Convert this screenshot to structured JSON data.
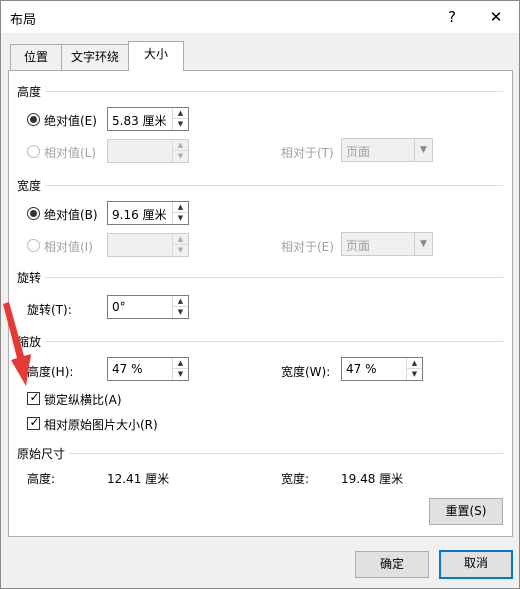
{
  "window": {
    "title": "布局",
    "help": "?",
    "close": "✕"
  },
  "tabs": [
    {
      "label": "位置"
    },
    {
      "label": "文字环绕"
    },
    {
      "label": "大小"
    }
  ],
  "height_section": {
    "title": "高度",
    "absolute_label": "绝对值(E)",
    "absolute_value": "5.83 厘米",
    "relative_label": "相对值(L)",
    "relative_to_label": "相对于(T)",
    "relative_to_value": "页面"
  },
  "width_section": {
    "title": "宽度",
    "absolute_label": "绝对值(B)",
    "absolute_value": "9.16 厘米",
    "relative_label": "相对值(I)",
    "relative_to_label": "相对于(E)",
    "relative_to_value": "页面"
  },
  "rotate_section": {
    "title": "旋转",
    "rotate_label": "旋转(T):",
    "rotate_value": "0°"
  },
  "scale_section": {
    "title": "缩放",
    "height_label": "高度(H):",
    "height_value": "47 %",
    "width_label": "宽度(W):",
    "width_value": "47 %",
    "lock_aspect_label": "锁定纵横比(A)",
    "relative_original_label": "相对原始图片大小(R)"
  },
  "original_section": {
    "title": "原始尺寸",
    "height_label": "高度:",
    "height_value": "12.41 厘米",
    "width_label": "宽度:",
    "width_value": "19.48 厘米"
  },
  "buttons": {
    "reset": "重置(S)",
    "ok": "确定",
    "cancel": "取消"
  },
  "colors": {
    "annotation_arrow": "#e53935",
    "default_button_border": "#0078d7"
  }
}
